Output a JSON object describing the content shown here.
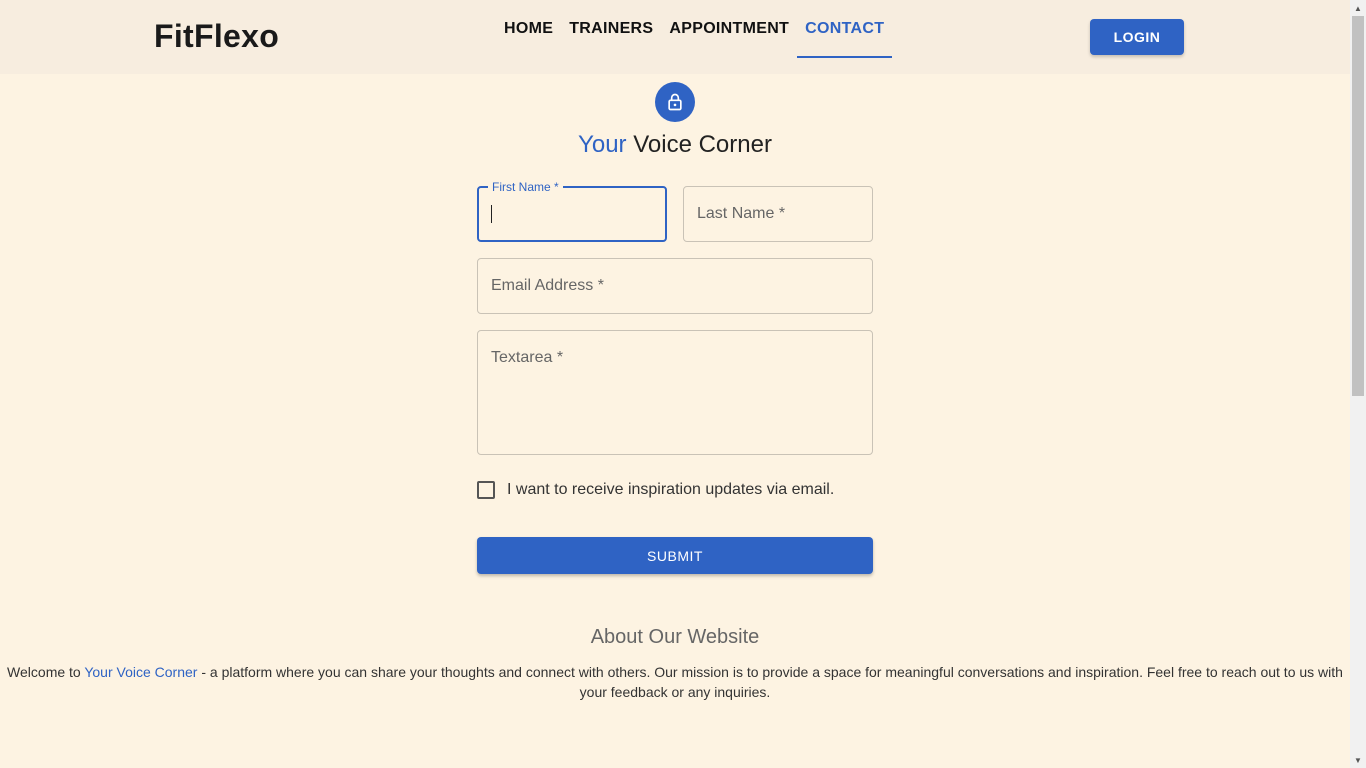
{
  "header": {
    "brand": "FitFlexo",
    "nav": [
      "HOME",
      "TRAINERS",
      "APPOINTMENT",
      "CONTACT"
    ],
    "active_nav": "CONTACT",
    "login_label": "LOGIN"
  },
  "form": {
    "icon": "lock-icon",
    "title_accent": "Your",
    "title_rest": " Voice Corner",
    "first_name_label": "First Name *",
    "last_name_placeholder": "Last Name *",
    "email_placeholder": "Email Address *",
    "textarea_placeholder": "Textarea *",
    "checkbox_label": "I want to receive inspiration updates via email.",
    "checkbox_checked": false,
    "submit_label": "SUBMIT"
  },
  "about": {
    "title": "About Our Website",
    "text_before": "Welcome to ",
    "text_accent": "Your Voice Corner",
    "text_after": " - a platform where you can share your thoughts and connect with others. Our mission is to provide a space for meaningful conversations and inspiration. Feel free to reach out to us with your feedback or any inquiries."
  },
  "colors": {
    "accent": "#2f63c4",
    "background": "#fdf3e2",
    "header_background": "#f7eddf"
  }
}
